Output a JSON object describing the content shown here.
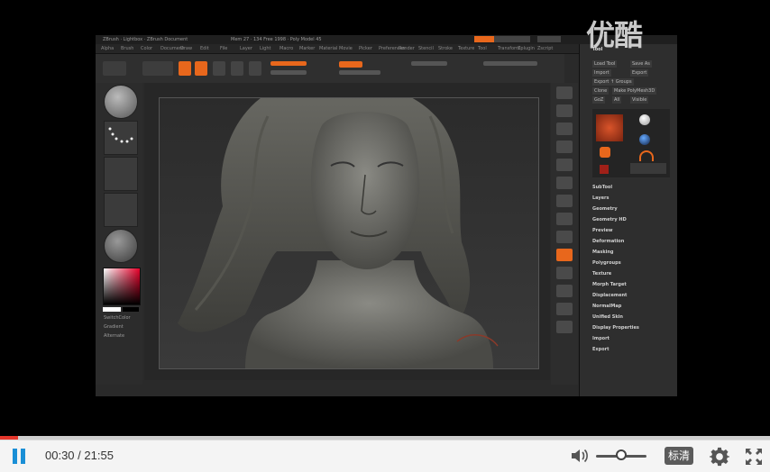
{
  "player": {
    "watermark": "优酷",
    "current_time": "00:30",
    "separator": " / ",
    "total_time": "21:55",
    "progress_fraction": 0.0229,
    "volume_fraction": 0.4,
    "quality_label": "标清",
    "colors": {
      "accent": "#1a8fd6",
      "progress": "#e5362b"
    }
  },
  "zbrush": {
    "title_left": "ZBrush · Lightbox · ZBrush Document",
    "title_mid": "Mem 27 · 134 Free 1998 · Poly Model 45",
    "menu_items": [
      "Alpha",
      "Brush",
      "Color",
      "Document",
      "Draw",
      "Edit",
      "File",
      "Layer",
      "Light",
      "Macro",
      "Marker",
      "Material",
      "Movie",
      "Picker",
      "Preferences",
      "Render",
      "Stencil",
      "Stroke",
      "Texture",
      "Tool",
      "Transform",
      "Zplugin",
      "Zscript"
    ],
    "tool_panel": {
      "title": "Tool",
      "buttons": [
        "Load Tool",
        "Save As",
        "Import",
        "Export",
        "Export ↑ Groups",
        "Clone",
        "Make PolyMesh3D",
        "GoZ",
        "All",
        "Visible"
      ],
      "sections": [
        "SubTool",
        "Layers",
        "Geometry",
        "Geometry HD",
        "Preview",
        "Deformation",
        "Masking",
        "Polygroups",
        "Texture",
        "Morph Target",
        "Displacement",
        "NormalMap",
        "Unified Skin",
        "Display Properties",
        "Import",
        "Export"
      ]
    },
    "shelf": {
      "draw": "Draw",
      "move": "Move",
      "scale": "Scale",
      "rotate": "Rotate",
      "zadd": "Zadd",
      "zsub": "Zsub",
      "mrgb": "Mrgb",
      "rgb": "Rgb",
      "m": "M"
    },
    "left_labels": [
      "SwitchColor",
      "Gradient",
      "Alternate"
    ],
    "canvas_figure": "sculpted female bust with long hair"
  }
}
